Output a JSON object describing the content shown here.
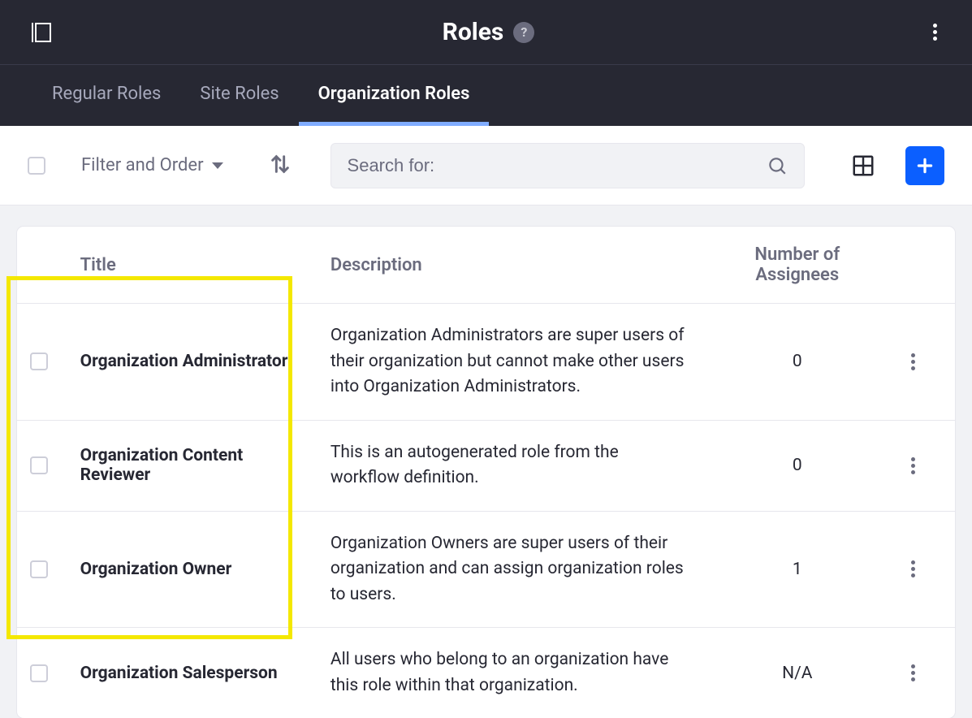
{
  "header": {
    "title": "Roles"
  },
  "tabs": [
    {
      "label": "Regular Roles",
      "active": false
    },
    {
      "label": "Site Roles",
      "active": false
    },
    {
      "label": "Organization Roles",
      "active": true
    }
  ],
  "toolbar": {
    "filter_label": "Filter and Order",
    "search_placeholder": "Search for:"
  },
  "table": {
    "columns": {
      "title": "Title",
      "description": "Description",
      "assignees": "Number of Assignees"
    },
    "rows": [
      {
        "title": "Organization Administrator",
        "description": "Organization Administrators are super users of their organization but cannot make other users into Organization Administrators.",
        "assignees": "0"
      },
      {
        "title": "Organization Content Reviewer",
        "description": "This is an autogenerated role from the workflow definition.",
        "assignees": "0"
      },
      {
        "title": "Organization Owner",
        "description": "Organization Owners are super users of their organization and can assign organization roles to users.",
        "assignees": "1"
      },
      {
        "title": "Organization Salesperson",
        "description": "All users who belong to an organization have this role within that organization.",
        "assignees": "N/A"
      }
    ]
  }
}
